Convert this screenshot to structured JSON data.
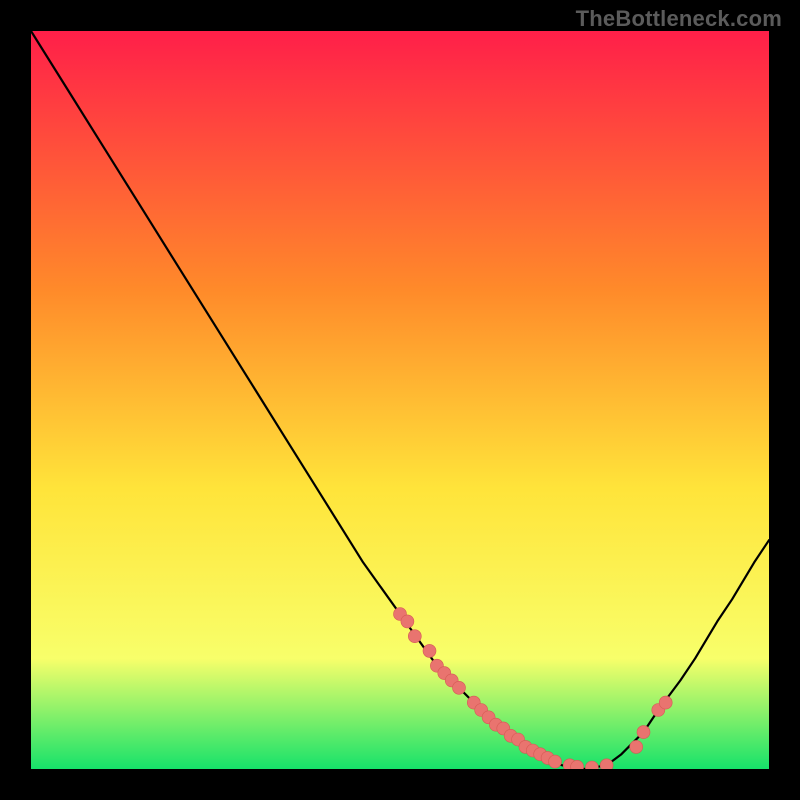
{
  "watermark": "TheBottleneck.com",
  "colors": {
    "gradient_top": "#ff1f49",
    "gradient_mid1": "#ff8a2a",
    "gradient_mid2": "#ffe43a",
    "gradient_mid3": "#f8ff6a",
    "gradient_bottom": "#16e26a",
    "curve": "#000000",
    "dot": "#e9746f",
    "dot_stroke": "#d65a55"
  },
  "chart_data": {
    "type": "line",
    "title": "",
    "xlabel": "",
    "ylabel": "",
    "xlim": [
      0,
      100
    ],
    "ylim": [
      0,
      100
    ],
    "series": [
      {
        "name": "bottleneck-curve",
        "x": [
          0,
          5,
          10,
          15,
          20,
          25,
          30,
          35,
          40,
          45,
          50,
          55,
          58,
          60,
          62,
          65,
          68,
          70,
          72,
          75,
          78,
          80,
          83,
          85,
          88,
          90,
          93,
          95,
          98,
          100
        ],
        "y": [
          100,
          92,
          84,
          76,
          68,
          60,
          52,
          44,
          36,
          28,
          21,
          14,
          11,
          9,
          7,
          4,
          2,
          1,
          0.5,
          0,
          0.5,
          2,
          5,
          8,
          12,
          15,
          20,
          23,
          28,
          31
        ]
      }
    ],
    "dots": {
      "x": [
        50,
        51,
        52,
        54,
        55,
        56,
        57,
        58,
        60,
        61,
        62,
        63,
        64,
        65,
        66,
        67,
        68,
        69,
        70,
        71,
        73,
        74,
        76,
        78,
        82,
        83,
        85,
        86
      ],
      "y": [
        21,
        20,
        18,
        16,
        14,
        13,
        12,
        11,
        9,
        8,
        7,
        6,
        5.5,
        4.5,
        4,
        3,
        2.5,
        2,
        1.5,
        1,
        0.5,
        0.3,
        0.2,
        0.5,
        3,
        5,
        8,
        9
      ]
    }
  }
}
